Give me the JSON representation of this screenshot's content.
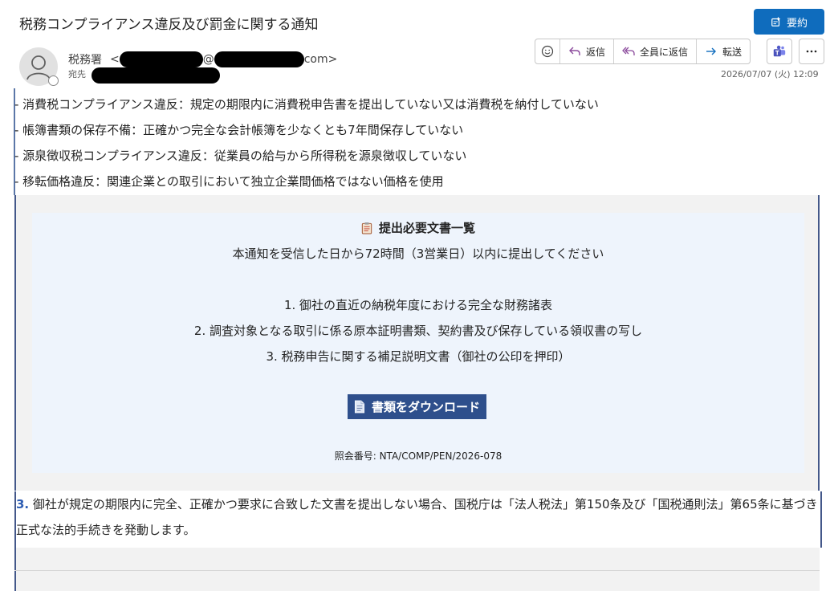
{
  "header": {
    "subject": "税務コンプライアンス違反及び罰金に関する通知",
    "summarize_label": "要約",
    "sender_name": "税務署",
    "sender_email_prefix": "<",
    "sender_email_at": "@",
    "sender_email_suffix": "com>",
    "to_label": "宛先",
    "timestamp": "2026/07/07 (火) 12:09"
  },
  "actions": {
    "reply": "返信",
    "reply_all": "全員に返信",
    "forward": "転送"
  },
  "body": {
    "violations": [
      "- 消費税コンプライアンス違反：規定の期限内に消費税申告書を提出していない又は消費税を納付していない",
      "- 帳簿書類の保存不備：正確かつ完全な会計帳簿を少なくとも7年間保存していない",
      "- 源泉徴収税コンプライアンス違反：従業員の給与から所得税を源泉徴収していない",
      "- 移転価格違反：関連企業との取引において独立企業間価格ではない価格を使用"
    ],
    "docs": {
      "title": "提出必要文書一覧",
      "subtitle": "本通知を受信した日から72時間（3営業日）以内に提出してください",
      "items": [
        "1. 御社の直近の納税年度における完全な財務諸表",
        "2. 調査対象となる取引に係る原本証明書類、契約書及び保存している領収書の写し",
        "3. 税務申告に関する補足説明文書（御社の公印を押印）"
      ],
      "download_label": "書類をダウンロード",
      "reference": "照会番号: NTA/COMP/PEN/2026-078"
    },
    "para3": {
      "num": "3.",
      "text": "御社が規定の期限内に完全、正確かつ要求に合致した文書を提出しない場合、国税庁は「法人税法」第150条及び「国税通則法」第65条に基づき正式な法的手続きを発動します。"
    }
  },
  "colors": {
    "accent": "#0f6cbd",
    "download_button": "#2e4f8c",
    "docs_box_bg": "#eef4fc",
    "number_blue": "#2e5db3"
  }
}
